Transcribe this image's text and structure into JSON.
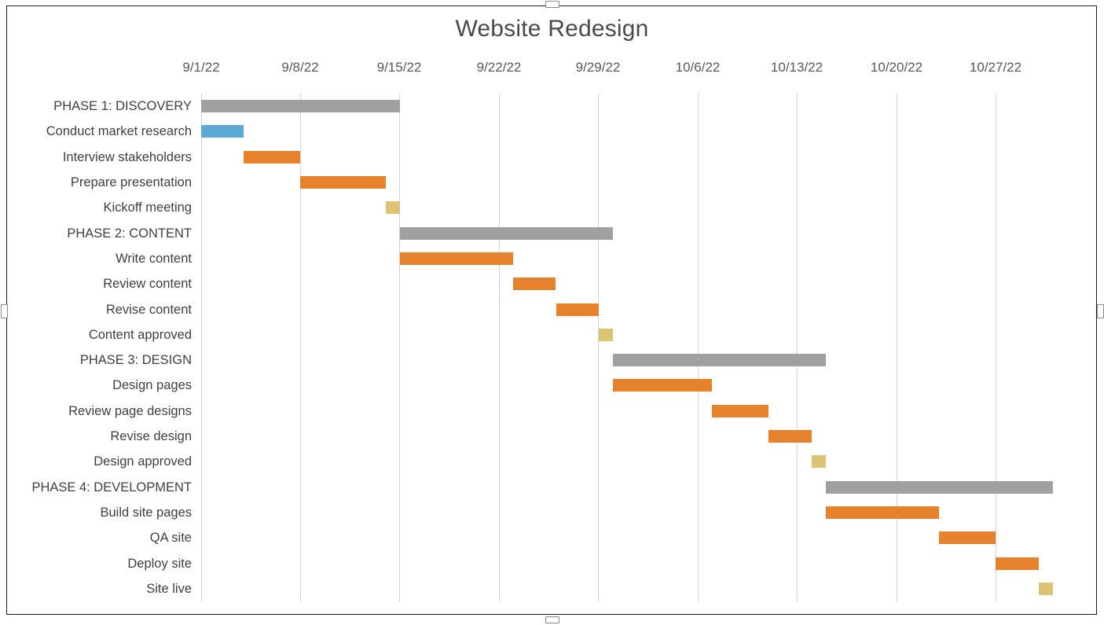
{
  "chart_title": "Website Redesign",
  "colors": {
    "phase": "#a0a0a0",
    "task": "#e5822b",
    "milestone": "#ddc474",
    "start": "#5ca9d6",
    "gridline": "#d4d4d4",
    "text": "#3f3f3f",
    "title_text": "#4a4a4a",
    "background": "#ffffff",
    "frame_border": "#1a1a1a"
  },
  "axis": {
    "ticks": [
      "9/1/22",
      "9/8/22",
      "9/15/22",
      "9/22/22",
      "9/29/22",
      "10/6/22",
      "10/13/22",
      "10/20/22",
      "10/27/22"
    ],
    "tick_x": [
      256,
      382,
      508,
      635,
      761,
      888,
      1014,
      1141,
      1267
    ],
    "day_width": 18.06,
    "origin_x": 256
  },
  "chart_data": {
    "type": "bar",
    "title": "Website Redesign",
    "xlabel": "",
    "ylabel": "",
    "orientation": "horizontal",
    "subtype": "gantt",
    "grid": true,
    "legend": "none",
    "axis_start": "9/1/22",
    "axis_end": "11/1/22",
    "xticks": [
      "9/1/22",
      "9/8/22",
      "9/15/22",
      "9/22/22",
      "9/29/22",
      "10/6/22",
      "10/13/22",
      "10/20/22",
      "10/27/22"
    ],
    "categories": [
      "PHASE 1: DISCOVERY",
      "Conduct market research",
      "Interview stakeholders",
      "Prepare presentation",
      "Kickoff meeting",
      "PHASE 2: CONTENT",
      "Write content",
      "Review content",
      "Revise content",
      "Content approved",
      "PHASE 3: DESIGN",
      "Design pages",
      "Review page designs",
      "Revise design",
      "Design approved",
      "PHASE 4: DEVELOPMENT",
      "Build site pages",
      "QA site",
      "Deploy site",
      "Site live"
    ],
    "tasks": [
      {
        "label": "PHASE 1: DISCOVERY",
        "kind": "phase",
        "start_day": 0,
        "duration_days": 14,
        "start_date": "9/1/22",
        "end_date": "9/15/22"
      },
      {
        "label": "Conduct market research",
        "kind": "start",
        "start_day": 0,
        "duration_days": 3,
        "start_date": "9/1/22",
        "end_date": "9/4/22"
      },
      {
        "label": "Interview stakeholders",
        "kind": "task",
        "start_day": 3,
        "duration_days": 4,
        "start_date": "9/4/22",
        "end_date": "9/8/22"
      },
      {
        "label": "Prepare presentation",
        "kind": "task",
        "start_day": 7,
        "duration_days": 6,
        "start_date": "9/8/22",
        "end_date": "9/14/22"
      },
      {
        "label": "Kickoff meeting",
        "kind": "milestone",
        "start_day": 13,
        "duration_days": 1,
        "start_date": "9/14/22",
        "end_date": "9/15/22"
      },
      {
        "label": "PHASE 2: CONTENT",
        "kind": "phase",
        "start_day": 14,
        "duration_days": 15,
        "start_date": "9/15/22",
        "end_date": "9/30/22"
      },
      {
        "label": "Write content",
        "kind": "task",
        "start_day": 14,
        "duration_days": 8,
        "start_date": "9/15/22",
        "end_date": "9/23/22"
      },
      {
        "label": "Review content",
        "kind": "task",
        "start_day": 22,
        "duration_days": 3,
        "start_date": "9/23/22",
        "end_date": "9/26/22"
      },
      {
        "label": "Revise content",
        "kind": "task",
        "start_day": 25,
        "duration_days": 3,
        "start_date": "9/26/22",
        "end_date": "9/29/22"
      },
      {
        "label": "Content approved",
        "kind": "milestone",
        "start_day": 28,
        "duration_days": 1,
        "start_date": "9/29/22",
        "end_date": "9/30/22"
      },
      {
        "label": "PHASE 3: DESIGN",
        "kind": "phase",
        "start_day": 29,
        "duration_days": 15,
        "start_date": "9/30/22",
        "end_date": "10/15/22"
      },
      {
        "label": "Design pages",
        "kind": "task",
        "start_day": 29,
        "duration_days": 7,
        "start_date": "9/30/22",
        "end_date": "10/7/22"
      },
      {
        "label": "Review page designs",
        "kind": "task",
        "start_day": 36,
        "duration_days": 4,
        "start_date": "10/7/22",
        "end_date": "10/11/22"
      },
      {
        "label": "Revise design",
        "kind": "task",
        "start_day": 40,
        "duration_days": 3,
        "start_date": "10/11/22",
        "end_date": "10/14/22"
      },
      {
        "label": "Design approved",
        "kind": "milestone",
        "start_day": 43,
        "duration_days": 1,
        "start_date": "10/14/22",
        "end_date": "10/15/22"
      },
      {
        "label": "PHASE 4: DEVELOPMENT",
        "kind": "phase",
        "start_day": 44,
        "duration_days": 16,
        "start_date": "10/15/22",
        "end_date": "10/31/22"
      },
      {
        "label": "Build site pages",
        "kind": "task",
        "start_day": 44,
        "duration_days": 8,
        "start_date": "10/15/22",
        "end_date": "10/23/22"
      },
      {
        "label": "QA site",
        "kind": "task",
        "start_day": 52,
        "duration_days": 4,
        "start_date": "10/23/22",
        "end_date": "10/27/22"
      },
      {
        "label": "Deploy site",
        "kind": "task",
        "start_day": 56,
        "duration_days": 3,
        "start_date": "10/27/22",
        "end_date": "10/30/22"
      },
      {
        "label": "Site live",
        "kind": "milestone",
        "start_day": 59,
        "duration_days": 1,
        "start_date": "10/30/22",
        "end_date": "10/31/22"
      }
    ]
  }
}
